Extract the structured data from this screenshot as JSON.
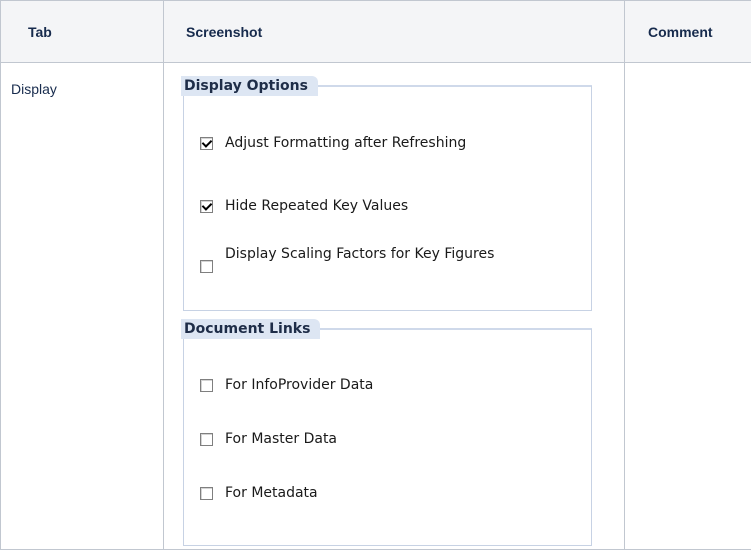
{
  "table": {
    "headers": {
      "tab": "Tab",
      "screenshot": "Screenshot",
      "comment": "Comment"
    },
    "row": {
      "tab": "Display",
      "comment": ""
    }
  },
  "screenshot": {
    "display_options": {
      "title": "Display Options",
      "options": [
        {
          "label": "Adjust Formatting after Refreshing",
          "checked": true
        },
        {
          "label": "Hide Repeated Key Values",
          "checked": true
        },
        {
          "label": "Display Scaling Factors for Key Figures",
          "checked": false
        }
      ]
    },
    "document_links": {
      "title": "Document Links",
      "options": [
        {
          "label": "For InfoProvider Data",
          "checked": false
        },
        {
          "label": "For Master Data",
          "checked": false
        },
        {
          "label": "For Metadata",
          "checked": false
        }
      ]
    }
  }
}
